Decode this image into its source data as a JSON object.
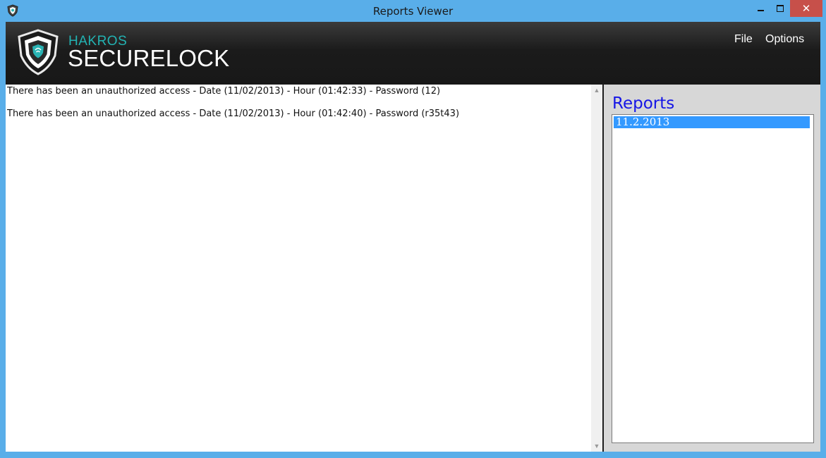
{
  "window": {
    "title": "Reports Viewer"
  },
  "brand": {
    "top": "HAKROS",
    "main": "SECURELOCK"
  },
  "menu": {
    "file": "File",
    "options": "Options"
  },
  "log": [
    "There has been an unauthorized access - Date (11/02/2013) - Hour (01:42:33) - Password (12)",
    "There has been an unauthorized access - Date (11/02/2013) - Hour (01:42:40) - Password (r35t43)"
  ],
  "reports": {
    "title": "Reports",
    "items": [
      "11.2.2013"
    ],
    "selected_index": 0
  },
  "colors": {
    "titlebar": "#59aee9",
    "header": "#1b1b1b",
    "brand_accent": "#22b3b3",
    "reports_title": "#1515e6",
    "selection": "#3399ff",
    "close_button": "#c7504a"
  }
}
